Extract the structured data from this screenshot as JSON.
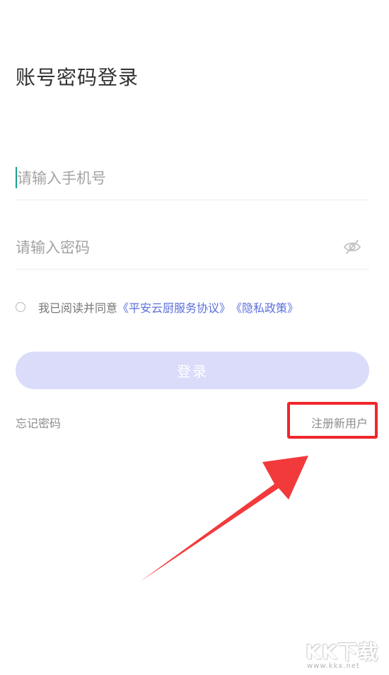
{
  "login": {
    "title": "账号密码登录",
    "phone_placeholder": "请输入手机号",
    "phone_value": "",
    "password_placeholder": "请输入密码",
    "password_value": "",
    "agreement_prefix": "我已阅读并同意",
    "agreement_service": "《平安云厨服务协议》",
    "agreement_privacy": "《隐私政策》",
    "agreement_checked": false,
    "login_button": "登录",
    "forgot_password": "忘记密码",
    "register": "注册新用户"
  },
  "annotation": {
    "highlight_color": "#f0262c",
    "arrow_color": "#f23a3c"
  },
  "colors": {
    "accent_link": "#5b6fdc",
    "button_disabled": "#dadcfa",
    "caret": "#18a08a"
  },
  "icons": {
    "password_toggle": "eye-closed-icon"
  },
  "watermark": {
    "logo": "KK下载",
    "url": "www.kkx.net"
  }
}
